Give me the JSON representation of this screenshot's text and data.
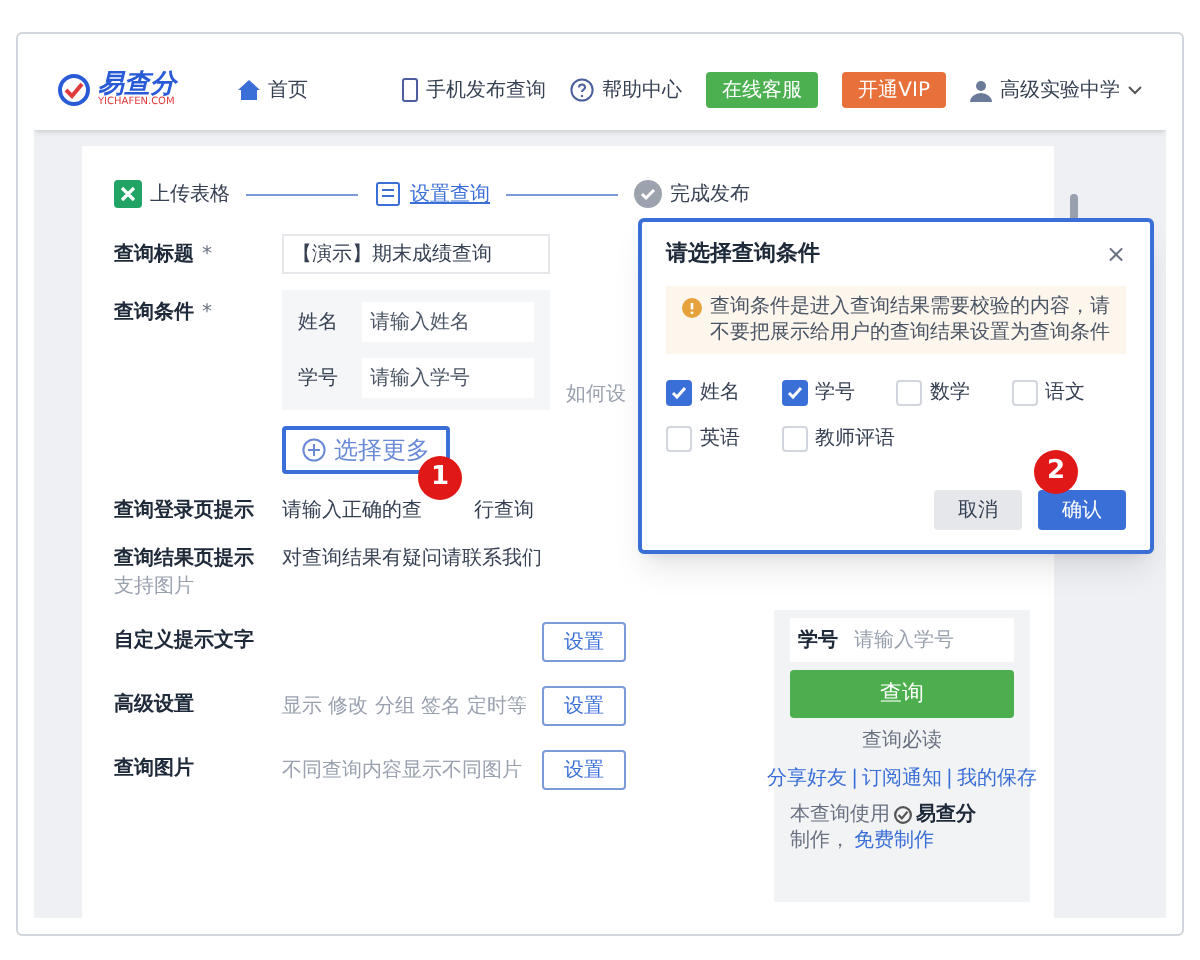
{
  "header": {
    "logo_text": "易查分",
    "logo_subtext": "YICHAFEN.COM",
    "home": "首页",
    "links": [
      {
        "label": "手机发布查询",
        "kind": "phone"
      },
      {
        "label": "帮助中心",
        "kind": "help"
      }
    ],
    "buttons": [
      {
        "label": "在线客服",
        "kind": "service"
      },
      {
        "label": "开通VIP",
        "kind": "vip"
      }
    ],
    "user": "高级实验中学"
  },
  "steps": [
    {
      "label": "上传表格",
      "kind": "sheet",
      "selected": false
    },
    {
      "label": "设置查询",
      "kind": "form",
      "selected": true
    },
    {
      "label": "完成发布",
      "kind": "done",
      "selected": false
    }
  ],
  "form": {
    "title_label": "查询标题",
    "title_mark": "*",
    "title_value": "【演示】期末成绩查询",
    "conditions_label": "查询条件",
    "conditions_mark": "*",
    "conditions": [
      {
        "name": "姓名",
        "placeholder": "请输入姓名"
      },
      {
        "name": "学号",
        "placeholder": "请输入学号"
      }
    ],
    "conditions_help": "如何设",
    "more_button": "选择更多",
    "more_badge": "1",
    "settings": [
      {
        "kind": "parts",
        "label": "查询登录页提示",
        "parts": [
          "请输入正确的查",
          "行查询"
        ]
      },
      {
        "kind": "text",
        "label": "查询结果页提示",
        "sublabel": "支持图片",
        "value": "对查询结果有疑问请联系我们"
      },
      {
        "kind": "button",
        "label": "自定义提示文字",
        "button": "设置"
      },
      {
        "kind": "button",
        "label": "高级设置",
        "hint": "显示 修改 分组 签名 定时等",
        "button": "设置"
      },
      {
        "kind": "button",
        "label": "查询图片",
        "hint": "不同查询内容显示不同图片",
        "button": "设置"
      }
    ]
  },
  "preview": {
    "field_label": "学号",
    "placeholder": "请输入学号",
    "button": "查询",
    "notice": "查询必读",
    "links": [
      "分享好友",
      "订阅通知",
      "我的保存"
    ],
    "separator": "|",
    "footer_before": "本查询使用",
    "footer_brand": "易查分",
    "footer_after": "制作，",
    "footer_link": "免费制作"
  },
  "dialog": {
    "title": "请选择查询条件",
    "close": "×",
    "notice": "查询条件是进入查询结果需要校验的内容，请不要把展示给用户的查询结果设置为查询条件",
    "options": [
      {
        "label": "姓名",
        "checked": true
      },
      {
        "label": "学号",
        "checked": true
      },
      {
        "label": "数学",
        "checked": false
      },
      {
        "label": "语文",
        "checked": false
      },
      {
        "label": "英语",
        "checked": false
      },
      {
        "label": "教师评语",
        "checked": false
      }
    ],
    "buttons": [
      {
        "label": "取消",
        "kind": "cancel"
      },
      {
        "label": "确认",
        "kind": "confirm"
      }
    ],
    "badge": "2"
  }
}
